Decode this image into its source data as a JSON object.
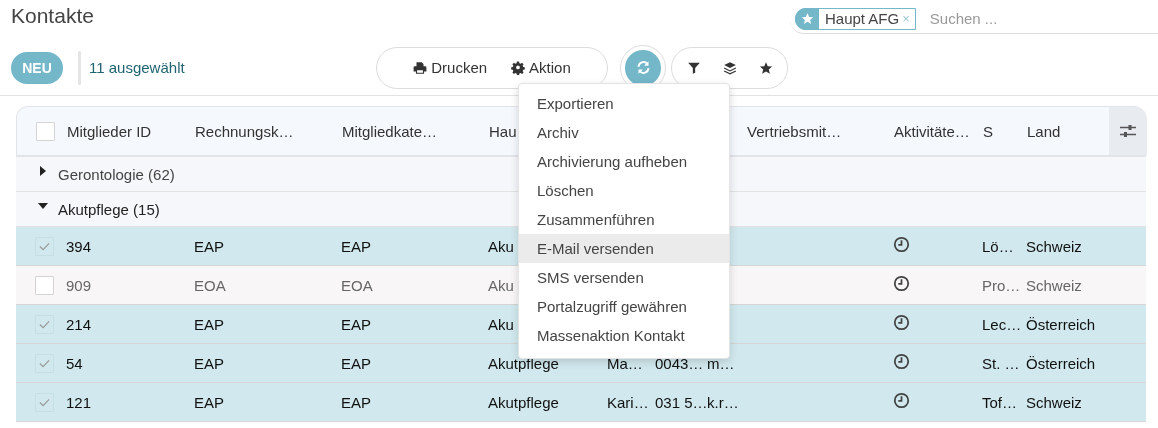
{
  "title": "Kontakte",
  "search": {
    "facet": {
      "label": "Haupt AFG",
      "remove": "×"
    },
    "placeholder": "Suchen ..."
  },
  "toolbar": {
    "new_button": "NEU",
    "selection_count": "11 ausgewählt",
    "print_button": "Drucken",
    "action_button": "Aktion"
  },
  "action_menu": {
    "items": [
      {
        "label": "Exportieren",
        "selected": false
      },
      {
        "label": "Archiv",
        "selected": false
      },
      {
        "label": "Archivierung aufheben",
        "selected": false
      },
      {
        "label": "Löschen",
        "selected": false
      },
      {
        "label": "Zusammenführen",
        "selected": false
      },
      {
        "label": "E-Mail versenden",
        "selected": true
      },
      {
        "label": "SMS versenden",
        "selected": false
      },
      {
        "label": "Portalzugriff gewähren",
        "selected": false
      },
      {
        "label": "Massenaktion Kontakt",
        "selected": false
      }
    ]
  },
  "table": {
    "header_checkbox": {
      "checked": false
    },
    "columns": [
      {
        "kind": "text",
        "label": "Mitglieder ID"
      },
      {
        "kind": "text",
        "label": "Rechnungsk…"
      },
      {
        "kind": "text",
        "label": "Mitgliedkate…"
      },
      {
        "kind": "text",
        "label": "Hau"
      },
      {
        "kind": "text"
      },
      {
        "kind": "text"
      },
      {
        "kind": "text"
      },
      {
        "kind": "text",
        "label": "Vertriebsmit…"
      },
      {
        "kind": "activity",
        "label": "Aktivitäte…"
      },
      {
        "kind": "text",
        "label": "S"
      },
      {
        "kind": "text",
        "label": "Land"
      }
    ],
    "groups": [
      {
        "label": "Gerontologie (62)",
        "expanded": false
      },
      {
        "label": "Akutpflege (15)",
        "expanded": true,
        "rows": [
          {
            "selected": true,
            "cells": [
              "394",
              "EAP",
              "EAP",
              "Aku",
              null,
              null,
              null,
              null,
              null,
              "Lö…",
              "Schweiz"
            ]
          },
          {
            "selected": false,
            "cells": [
              "909",
              "EOA",
              "EOA",
              "Aku",
              null,
              null,
              null,
              null,
              null,
              "Pro…",
              "Schweiz"
            ]
          },
          {
            "selected": true,
            "cells": [
              "214",
              "EAP",
              "EAP",
              "Aku",
              null,
              null,
              null,
              null,
              null,
              "Lec…",
              "Österreich"
            ]
          },
          {
            "selected": true,
            "cells": [
              "54",
              "EAP",
              "EAP",
              "Akutpflege",
              "Ma…",
              "0043…",
              "m…",
              null,
              null,
              "St. …",
              "Österreich"
            ]
          },
          {
            "selected": true,
            "cells": [
              "121",
              "EAP",
              "EAP",
              "Akutpflege",
              "Kari…",
              "031 5…",
              "k.r…",
              null,
              null,
              "Tof…",
              "Schweiz"
            ]
          }
        ]
      }
    ]
  }
}
